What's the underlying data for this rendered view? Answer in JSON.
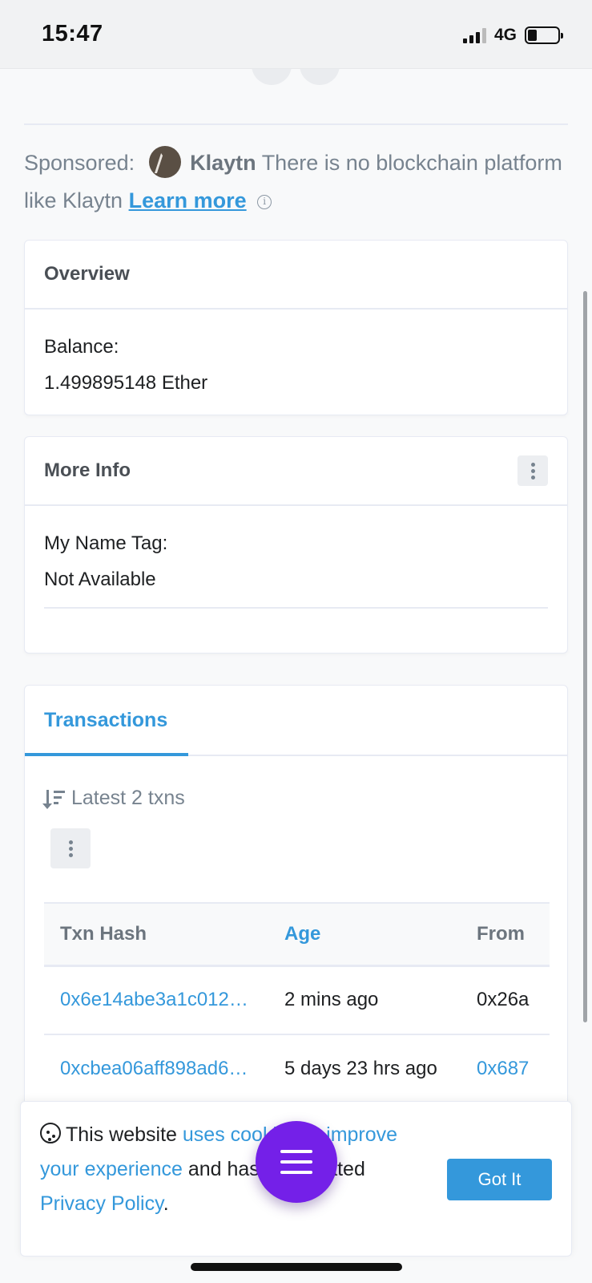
{
  "status_bar": {
    "time": "15:47",
    "network": "4G"
  },
  "sponsored": {
    "prefix": "Sponsored:",
    "brand": "Klaytn",
    "text": "There is no blockchain platform like Klaytn",
    "link": "Learn more",
    "info_glyph": "i"
  },
  "overview": {
    "title": "Overview",
    "balance_label": "Balance:",
    "balance_value": "1.499895148 Ether"
  },
  "more_info": {
    "title": "More Info",
    "name_tag_label": "My Name Tag:",
    "name_tag_value": "Not Available"
  },
  "transactions": {
    "tab": "Transactions",
    "latest": "Latest 2 txns",
    "columns": [
      "Txn Hash",
      "Age",
      "From"
    ],
    "rows": [
      {
        "hash": "0x6e14abe3a1c012…",
        "age": "2 mins ago",
        "from": "0x26a"
      },
      {
        "hash": "0xcbea06aff898ad6…",
        "age": "5 days 23 hrs ago",
        "from": "0x687"
      }
    ]
  },
  "cookie": {
    "t1": "This website ",
    "link1": "uses cookies to improve your experience",
    "t2": " and has an updated ",
    "link2": "Privacy Policy",
    "t3": ".",
    "button": "Got It"
  },
  "colors": {
    "accent": "#3498db",
    "fab": "#7420e8",
    "muted": "#77838f"
  }
}
